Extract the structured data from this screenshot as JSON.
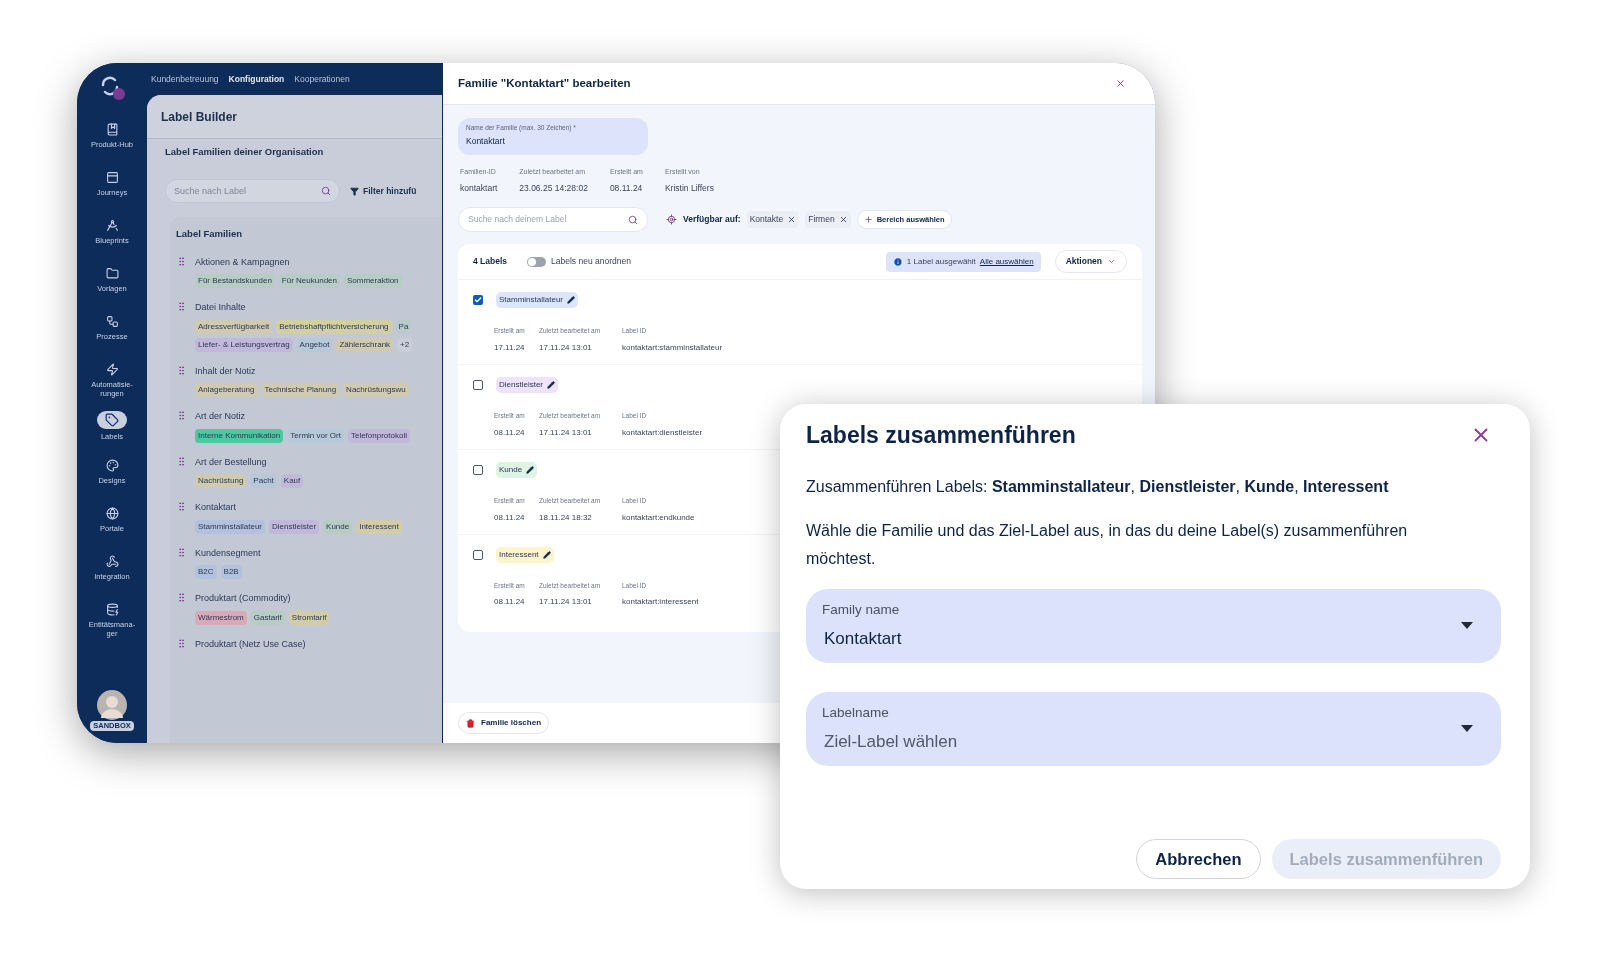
{
  "nav": {
    "items": [
      {
        "label": "Kundenbetreuung",
        "selected": false
      },
      {
        "label": "Konfiguration",
        "selected": true
      },
      {
        "label": "Kooperationen",
        "selected": false
      }
    ]
  },
  "sidebar": {
    "items": [
      {
        "label": "Produkt-Hub",
        "selected": false
      },
      {
        "label": "Journeys",
        "selected": false
      },
      {
        "label": "Blueprints",
        "selected": false
      },
      {
        "label": "Vorlagen",
        "selected": false
      },
      {
        "label": "Prozesse",
        "selected": false
      },
      {
        "label": "Automatisie-\nrungen",
        "selected": false
      },
      {
        "label": "Labels",
        "selected": true
      },
      {
        "label": "Designs",
        "selected": false
      },
      {
        "label": "Portale",
        "selected": false
      },
      {
        "label": "Integration",
        "selected": false
      },
      {
        "label": "Entitätsmana-\nger",
        "selected": false
      }
    ],
    "avatar_badge": "SANDBOX"
  },
  "label_builder": {
    "title": "Label Builder",
    "subtitle": "Label Familien deiner Organisation",
    "search": {
      "placeholder": "Suche nach Label"
    },
    "filter_button": "Filter hinzufü",
    "families_title": "Label Familien",
    "families": [
      {
        "name": "Aktionen & Kampagnen",
        "tags": [
          {
            "label": "Für Bestandskunden",
            "color": "#b7cdc4"
          },
          {
            "label": "Für Neukunden",
            "color": "#b7cdc4"
          },
          {
            "label": "Sommeraktion",
            "color": "#b7cdc4"
          }
        ]
      },
      {
        "name": "Datei Inhalte",
        "tags": [
          {
            "label": "Adressverfügbarkeit",
            "color": "#d0cbb0"
          },
          {
            "label": "Betriebshaftpflichtversicherung",
            "color": "#d3d0a0"
          },
          {
            "label": "Pa",
            "color": "#b9cbc8"
          },
          {
            "label": "Liefer- & Leistungsvertrag",
            "color": "#c2b9da"
          },
          {
            "label": "Angebot",
            "color": "#b5c9d9"
          },
          {
            "label": "Zählerschrank",
            "color": "#d0cbb0"
          },
          {
            "label": "+2",
            "color": "#c9ced9"
          }
        ]
      },
      {
        "name": "Inhalt der Notiz",
        "tags": [
          {
            "label": "Anlageberatung",
            "color": "#d0cbb0"
          },
          {
            "label": "Technische Planung",
            "color": "#d0cbb0"
          },
          {
            "label": "Nachrüstungswu",
            "color": "#d0cbb0"
          }
        ]
      },
      {
        "name": "Art der Notiz",
        "tags": [
          {
            "label": "Interne Kommunikation",
            "color": "#4dc9a0"
          },
          {
            "label": "Termin vor Ort",
            "color": "#b5c9d9"
          },
          {
            "label": "Telefonprotokoll",
            "color": "#c2b9da"
          }
        ]
      },
      {
        "name": "Art der Bestellung",
        "tags": [
          {
            "label": "Nachrüstung",
            "color": "#d0cbb0"
          },
          {
            "label": "Pacht",
            "color": "#b5c9d9"
          },
          {
            "label": "Kauf",
            "color": "#c2b9da"
          }
        ]
      },
      {
        "name": "Kontaktart",
        "tags": [
          {
            "label": "Stamminstallateur",
            "color": "#b3c1dc"
          },
          {
            "label": "Dienstleister",
            "color": "#c2b9da"
          },
          {
            "label": "Kunde",
            "color": "#b7cdc4"
          },
          {
            "label": "Interessent",
            "color": "#d3cca8"
          }
        ]
      },
      {
        "name": "Kundensegment",
        "tags": [
          {
            "label": "B2C",
            "color": "#b3c1dc"
          },
          {
            "label": "B2B",
            "color": "#b3c1dc"
          }
        ]
      },
      {
        "name": "Produktart (Commodity)",
        "tags": [
          {
            "label": "Wärmestrom",
            "color": "#d8aab8"
          },
          {
            "label": "Gastarif",
            "color": "#b7cdc4"
          },
          {
            "label": "Stromtarif",
            "color": "#d3cca8"
          }
        ]
      },
      {
        "name": "Produktart (Netz Use Case)"
      }
    ]
  },
  "edit_panel": {
    "title": "Familie \"Kontaktart\" bearbeiten",
    "name_field": {
      "label": "Name der Familie (max. 30 Zeichen) *",
      "value": "Kontaktart"
    },
    "meta": [
      {
        "label": "Familien-ID",
        "value": "kontaktart"
      },
      {
        "label": "Zuletzt bearbeitet am",
        "value": "23.06.25 14:28:02"
      },
      {
        "label": "Erstellt am",
        "value": "08.11.24"
      },
      {
        "label": "Erstellt von",
        "value": "Kristin Liffers"
      }
    ],
    "search": {
      "placeholder": "Suche nach deinem Label"
    },
    "available_label": "Verfügbar auf:",
    "available_on": [
      "Kontakte",
      "Firmen"
    ],
    "add_scope_button": "Bereich auswählen",
    "count": "4 Labels",
    "reorder_toggle": {
      "label": "Labels neu anordnen",
      "on": false
    },
    "selection_info": "1 Label ausgewählt",
    "select_all_link": "Alle auswählen",
    "actions_button": "Aktionen",
    "labels": [
      {
        "name": "Stamminstallateur",
        "color": "#dbe5fb",
        "checked": true,
        "meta": [
          {
            "label": "Erstellt am",
            "value": "17.11.24"
          },
          {
            "label": "Zuletzt bearbeitet am",
            "value": "17.11.24 13:01"
          },
          {
            "label": "Label ID",
            "value": "kontaktart:stamminstallateur"
          }
        ]
      },
      {
        "name": "Dienstleister",
        "color": "#efe2fb",
        "checked": false,
        "meta": [
          {
            "label": "Erstellt am",
            "value": "08.11.24"
          },
          {
            "label": "Zuletzt bearbeitet am",
            "value": "17.11.24 13:01"
          },
          {
            "label": "Label ID",
            "value": "kontaktart:dienstleister"
          }
        ]
      },
      {
        "name": "Kunde",
        "color": "#ddf3e3",
        "checked": false,
        "meta": [
          {
            "label": "Erstellt am",
            "value": "08.11.24"
          },
          {
            "label": "Zuletzt bearbeitet am",
            "value": "18.11.24 18:32"
          },
          {
            "label": "Label ID",
            "value": "kontaktart:endkunde"
          }
        ]
      },
      {
        "name": "Interessent",
        "color": "#fdf3cd",
        "checked": false,
        "meta": [
          {
            "label": "Erstellt am",
            "value": "08.11.24"
          },
          {
            "label": "Zuletzt bearbeitet am",
            "value": "17.11.24 13:01"
          },
          {
            "label": "Label ID",
            "value": "kontaktart:interessent"
          }
        ]
      }
    ],
    "delete_button": "Familie löschen"
  },
  "merge_dialog": {
    "title": "Labels zusammenführen",
    "summary": "Zusammenführen Labels: **Stamminstallateur**, **Dienstleister**, **Kunde**, **Interessent**",
    "instruction": "Wähle die Familie und das Ziel-Label aus, in das du deine Label(s) zusammenführen möchtest.",
    "fields": [
      {
        "label": "Family name",
        "value": "Kontaktart"
      },
      {
        "label": "Labelname",
        "placeholder": "Ziel-Label wählen"
      }
    ],
    "buttons": [
      {
        "label": "Abbrechen",
        "kind": "secondary",
        "disabled": false
      },
      {
        "label": "Labels zusammenführen",
        "kind": "primary",
        "disabled": true
      }
    ]
  }
}
